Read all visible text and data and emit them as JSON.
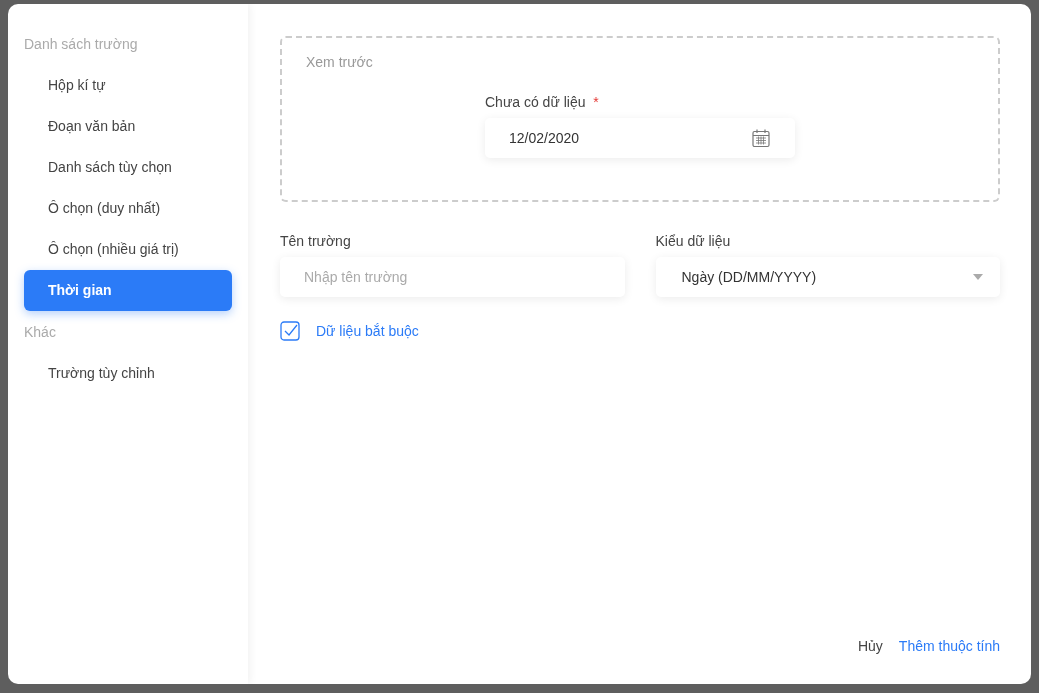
{
  "sidebar": {
    "groups": [
      {
        "title": "Danh sách trường",
        "items": [
          {
            "label": "Hộp kí tự",
            "selected": false
          },
          {
            "label": "Đoạn văn bản",
            "selected": false
          },
          {
            "label": "Danh sách tùy chọn",
            "selected": false
          },
          {
            "label": "Ô chọn (duy nhất)",
            "selected": false
          },
          {
            "label": "Ô chọn (nhiều giá trị)",
            "selected": false
          },
          {
            "label": "Thời gian",
            "selected": true
          }
        ]
      },
      {
        "title": "Khác",
        "items": [
          {
            "label": "Trường tùy chỉnh",
            "selected": false
          }
        ]
      }
    ]
  },
  "preview": {
    "title": "Xem trước",
    "field": {
      "label": "Chưa có dữ liệu",
      "required": true,
      "required_mark": "*",
      "value": "12/02/2020"
    }
  },
  "name_field": {
    "label": "Tên trường",
    "placeholder": "Nhập tên trường"
  },
  "type_field": {
    "label": "Kiểu dữ liệu",
    "value": "Ngày (DD/MM/YYYY)"
  },
  "required_checkbox": {
    "label": "Dữ liệu bắt buộc",
    "checked": true
  },
  "footer": {
    "cancel": "Hủy",
    "submit": "Thêm thuộc tính"
  }
}
